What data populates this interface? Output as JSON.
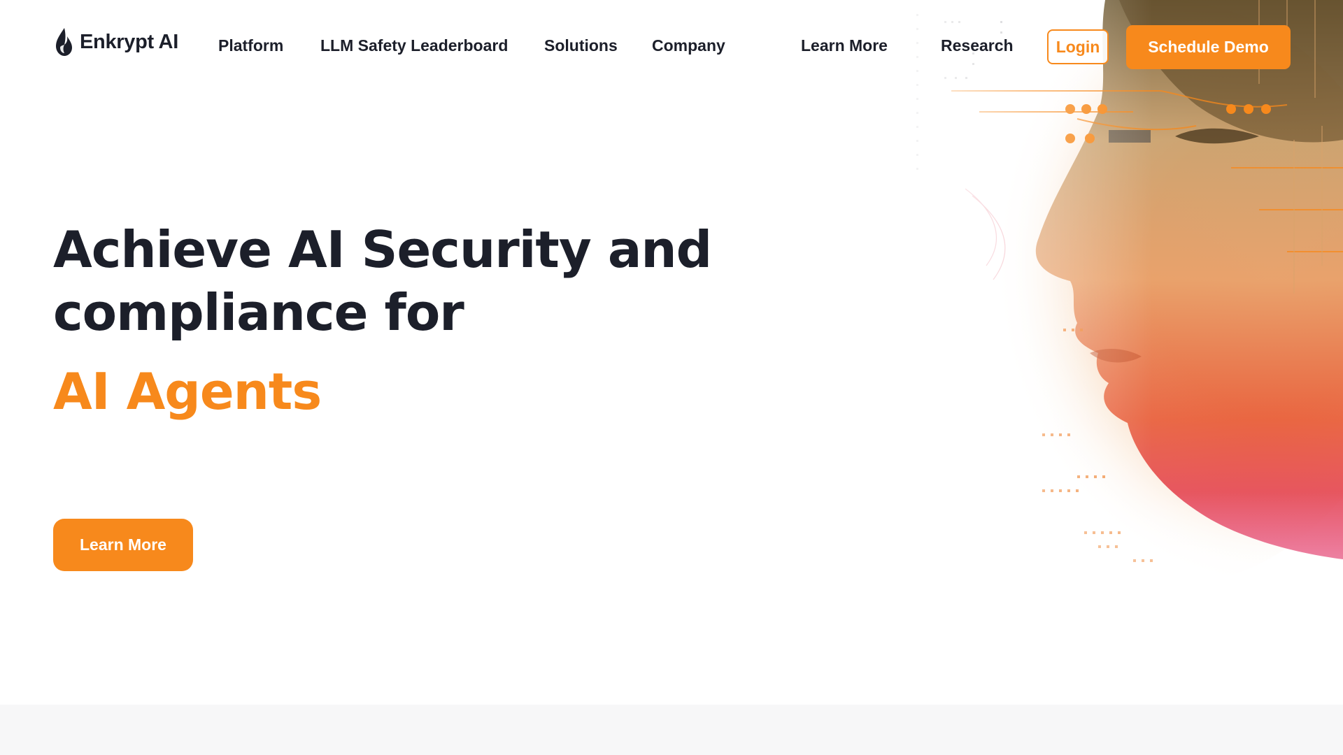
{
  "brand": {
    "name": "Enkrypt AI",
    "logo_icon": "flame-drop-logo-icon"
  },
  "nav": {
    "items": [
      {
        "label": "Platform"
      },
      {
        "label": "LLM Safety Leaderboard"
      },
      {
        "label": "Solutions"
      },
      {
        "label": "Company"
      },
      {
        "label": "Learn More"
      },
      {
        "label": "Research"
      }
    ],
    "login_label": "Login",
    "demo_label": "Schedule Demo"
  },
  "hero": {
    "title_line1": "Achieve AI Security and",
    "title_line2": "compliance for",
    "title_accent": "AI Agents",
    "cta_label": "Learn More",
    "image": "ai-face-circuit-illustration"
  },
  "colors": {
    "accent": "#f7891c",
    "text_dark": "#1c1f2a",
    "background": "#ffffff",
    "bottom_band": "#f7f7f8"
  }
}
